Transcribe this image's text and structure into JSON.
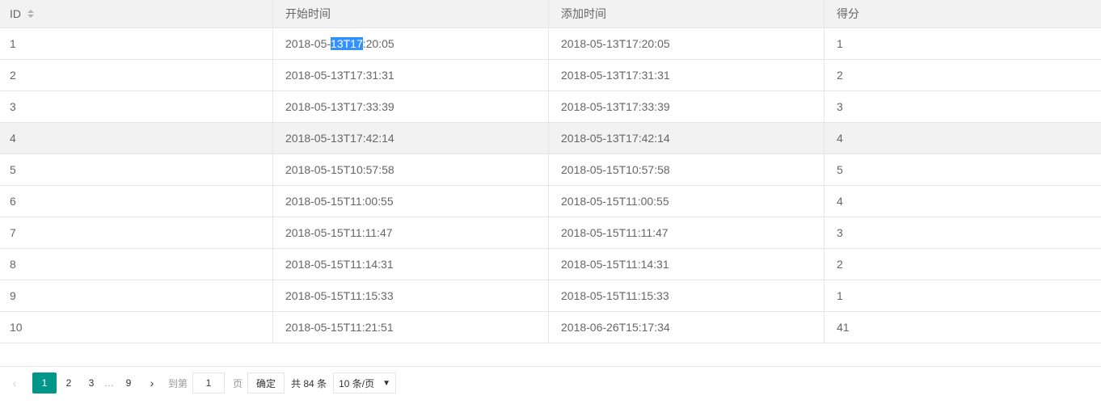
{
  "table": {
    "headers": [
      "ID",
      "开始时间",
      "添加时间",
      "得分"
    ],
    "rows": [
      {
        "id": "1",
        "start": "2018-05-13T17:20:05",
        "added": "2018-05-13T17:20:05",
        "score": "1"
      },
      {
        "id": "2",
        "start": "2018-05-13T17:31:31",
        "added": "2018-05-13T17:31:31",
        "score": "2"
      },
      {
        "id": "3",
        "start": "2018-05-13T17:33:39",
        "added": "2018-05-13T17:33:39",
        "score": "3"
      },
      {
        "id": "4",
        "start": "2018-05-13T17:42:14",
        "added": "2018-05-13T17:42:14",
        "score": "4"
      },
      {
        "id": "5",
        "start": "2018-05-15T10:57:58",
        "added": "2018-05-15T10:57:58",
        "score": "5"
      },
      {
        "id": "6",
        "start": "2018-05-15T11:00:55",
        "added": "2018-05-15T11:00:55",
        "score": "4"
      },
      {
        "id": "7",
        "start": "2018-05-15T11:11:47",
        "added": "2018-05-15T11:11:47",
        "score": "3"
      },
      {
        "id": "8",
        "start": "2018-05-15T11:14:31",
        "added": "2018-05-15T11:14:31",
        "score": "2"
      },
      {
        "id": "9",
        "start": "2018-05-15T11:15:33",
        "added": "2018-05-15T11:15:33",
        "score": "1"
      },
      {
        "id": "10",
        "start": "2018-05-15T11:21:51",
        "added": "2018-06-26T15:17:34",
        "score": "41"
      }
    ],
    "selected_text": {
      "prefix": "2018-05-",
      "selected": "13T17",
      "suffix": ":20:05"
    }
  },
  "pager": {
    "prev": "‹",
    "pages": [
      "1",
      "2",
      "3"
    ],
    "ellipsis": "…",
    "last_page": "9",
    "next": "›",
    "goto_label": "到第",
    "goto_value": "1",
    "page_unit": "页",
    "confirm": "确定",
    "total": "共 84 条",
    "per_page": "10 条/页",
    "caret": "▼",
    "accent": "#009688"
  },
  "colors": {
    "selection": "#3390ff",
    "header_bg": "#f2f2f2",
    "border": "#e6e6e6"
  }
}
